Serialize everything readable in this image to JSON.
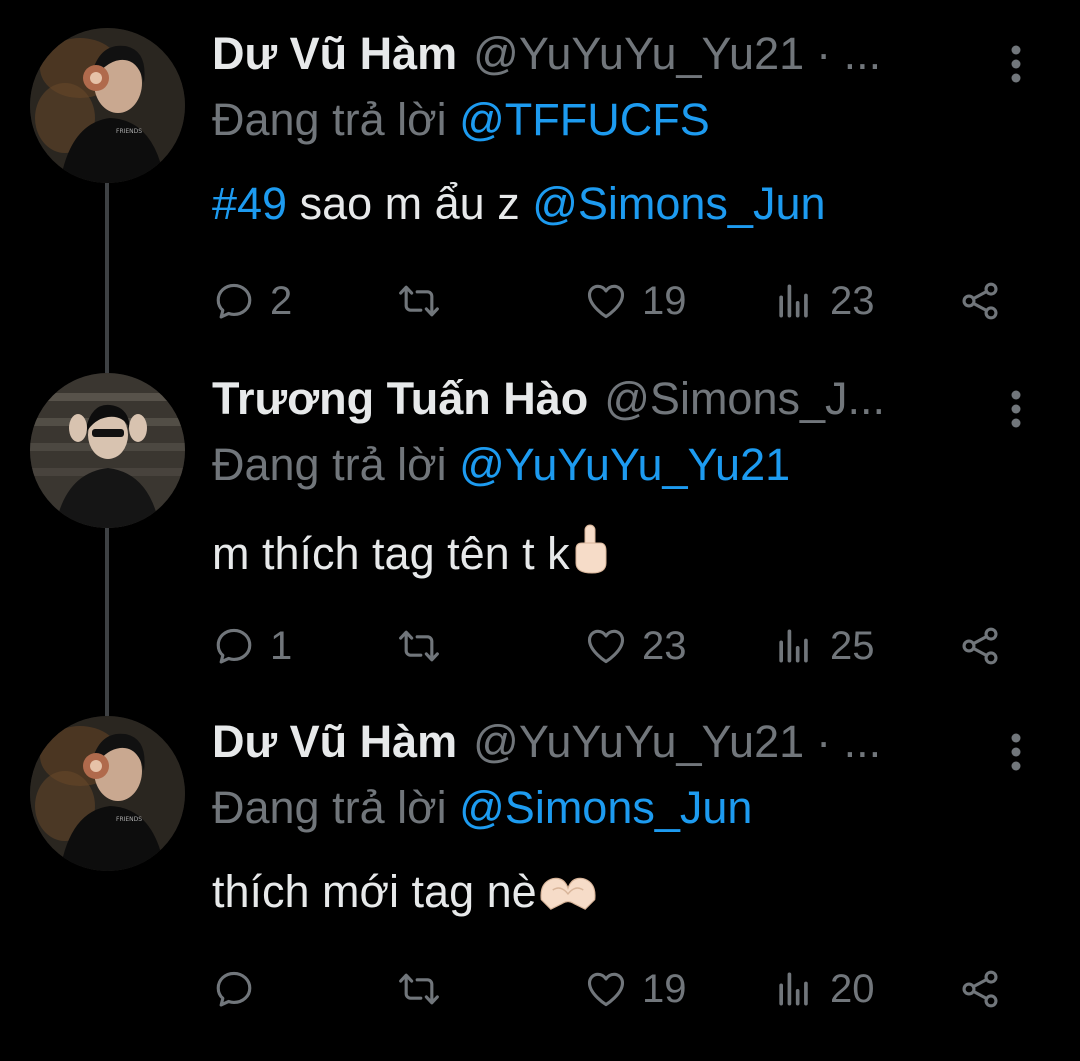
{
  "replying_label": "Đang trả lời",
  "tweets": [
    {
      "name": "Dư Vũ Hàm",
      "handle": "@YuYuYu_Yu21",
      "separator": "· ...",
      "reply_to": "@TFFUCFS",
      "hashtag": "#49",
      "text": " sao m ẩu z ",
      "mention": "@Simons_Jun",
      "stats": {
        "replies": "2",
        "retweets": "",
        "likes": "19",
        "views": "23"
      }
    },
    {
      "name": "Trương Tuấn Hào",
      "handle": "@Simons_J...",
      "separator": "",
      "reply_to": "@YuYuYu_Yu21",
      "text": "m thích tag tên t k",
      "stats": {
        "replies": "1",
        "retweets": "",
        "likes": "23",
        "views": "25"
      }
    },
    {
      "name": "Dư Vũ Hàm",
      "handle": "@YuYuYu_Yu21",
      "separator": "· ...",
      "reply_to": "@Simons_Jun",
      "text": "thích mới tag nè",
      "stats": {
        "replies": "",
        "retweets": "",
        "likes": "19",
        "views": "20"
      }
    }
  ],
  "icons": {
    "reply": "reply-icon",
    "retweet": "retweet-icon",
    "like": "heart-icon",
    "views": "views-icon",
    "share": "share-icon",
    "more": "more-vertical-icon"
  },
  "colors": {
    "background": "#000000",
    "text": "#e7e9ea",
    "muted": "#71767b",
    "link": "#1d9bf0",
    "thread_line": "#3e4144"
  }
}
